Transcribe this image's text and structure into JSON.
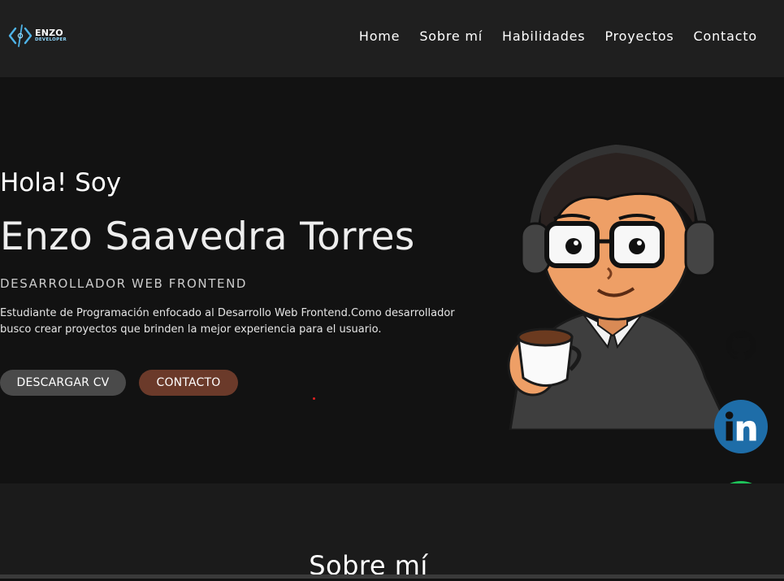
{
  "logo": {
    "name": "ENZO",
    "subtitle": "DEVELOPER",
    "icon": "code-brackets-icon"
  },
  "nav": {
    "items": [
      {
        "label": "Home"
      },
      {
        "label": "Sobre mí"
      },
      {
        "label": "Habilidades"
      },
      {
        "label": "Proyectos"
      },
      {
        "label": "Contacto"
      }
    ]
  },
  "hero": {
    "greeting": "Hola! Soy",
    "name": "Enzo Saavedra Torres",
    "role": "DESARROLLADOR WEB FRONTEND",
    "description": "Estudiante de Programación enfocado al Desarrollo Web Frontend.Como desarrollador busco crear proyectos que brinden la mejor experiencia para el usuario.",
    "buttons": {
      "cv": "DESCARGAR CV",
      "contact": "CONTACTO"
    },
    "image": "avatar-illustration"
  },
  "social": {
    "github": "github-icon",
    "linkedin": "linkedin-icon",
    "whatsapp": "whatsapp-icon"
  },
  "about": {
    "title": "Sobre mí"
  },
  "colors": {
    "header_bg": "#1f1f1f",
    "page_bg": "#121212",
    "cv_button": "#4a4a4a",
    "contact_button": "#6b3a2a",
    "linkedin": "#1e6da8",
    "whatsapp": "#1ec35a"
  }
}
